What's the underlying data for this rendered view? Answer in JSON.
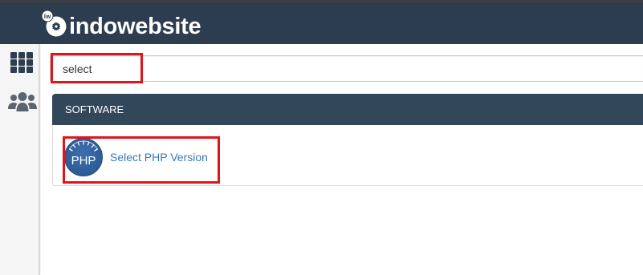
{
  "header": {
    "brand": "indowebsite",
    "logo_mark": "iw",
    "logo_icon": "indowebsite-logo-icon"
  },
  "sidebar": {
    "items": [
      {
        "icon": "grid-icon"
      },
      {
        "icon": "users-icon"
      }
    ]
  },
  "search": {
    "value": "select"
  },
  "results": {
    "sections": [
      {
        "title": "SOFTWARE",
        "items": [
          {
            "label": "Select PHP Version",
            "icon": "php-icon",
            "icon_text": "PHP"
          }
        ]
      }
    ]
  },
  "colors": {
    "top_strip": "#3b4046",
    "header_bg": "#2c3d4f",
    "sidebar_bg": "#f5f5f5",
    "sidebar_border": "#d9d9d9",
    "icon_active": "#2d3e50",
    "icon_muted": "#5a6570",
    "panel_header_bg": "#33475b",
    "link": "#3b78b3",
    "php_badge": "#2c5a94",
    "highlight": "#e3131b"
  }
}
